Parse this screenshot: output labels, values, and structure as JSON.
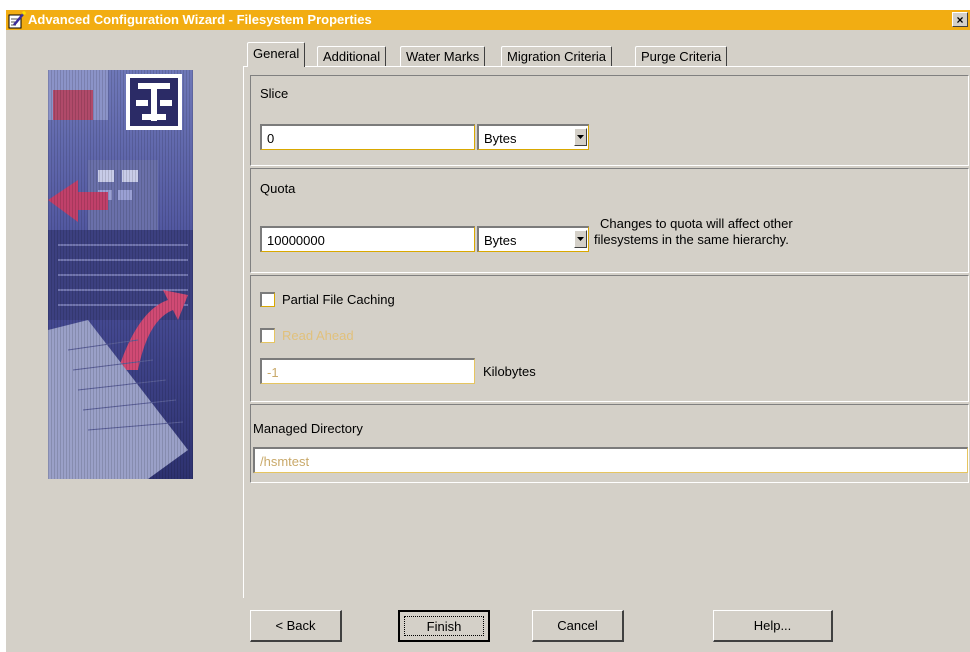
{
  "window": {
    "title": "Advanced Configuration Wizard - Filesystem Properties",
    "close_label": "×"
  },
  "tabs": [
    {
      "label": "General",
      "active": true
    },
    {
      "label": "Additional",
      "active": false
    },
    {
      "label": "Water Marks",
      "active": false
    },
    {
      "label": "Migration Criteria",
      "active": false
    },
    {
      "label": "Purge Criteria",
      "active": false
    }
  ],
  "slice": {
    "label": "Slice",
    "value": "0",
    "unit": "Bytes"
  },
  "quota": {
    "label": "Quota",
    "value": "10000000",
    "unit": "Bytes",
    "note_line1": "Changes to quota will affect other",
    "note_line2": "filesystems in the same hierarchy."
  },
  "caching": {
    "partial_label": "Partial File Caching",
    "partial_checked": false,
    "read_ahead_label": "Read Ahead",
    "read_ahead_checked": false,
    "read_ahead_value": "-1",
    "read_ahead_unit": "Kilobytes"
  },
  "managed_directory": {
    "label": "Managed Directory",
    "value": "/hsmtest"
  },
  "buttons": {
    "back": "< Back",
    "finish": "Finish",
    "cancel": "Cancel",
    "help": "Help..."
  },
  "colors": {
    "titlebar": "#f2ad12",
    "dialog": "#d4d0c8",
    "disabled_text": "#e1c17c"
  }
}
